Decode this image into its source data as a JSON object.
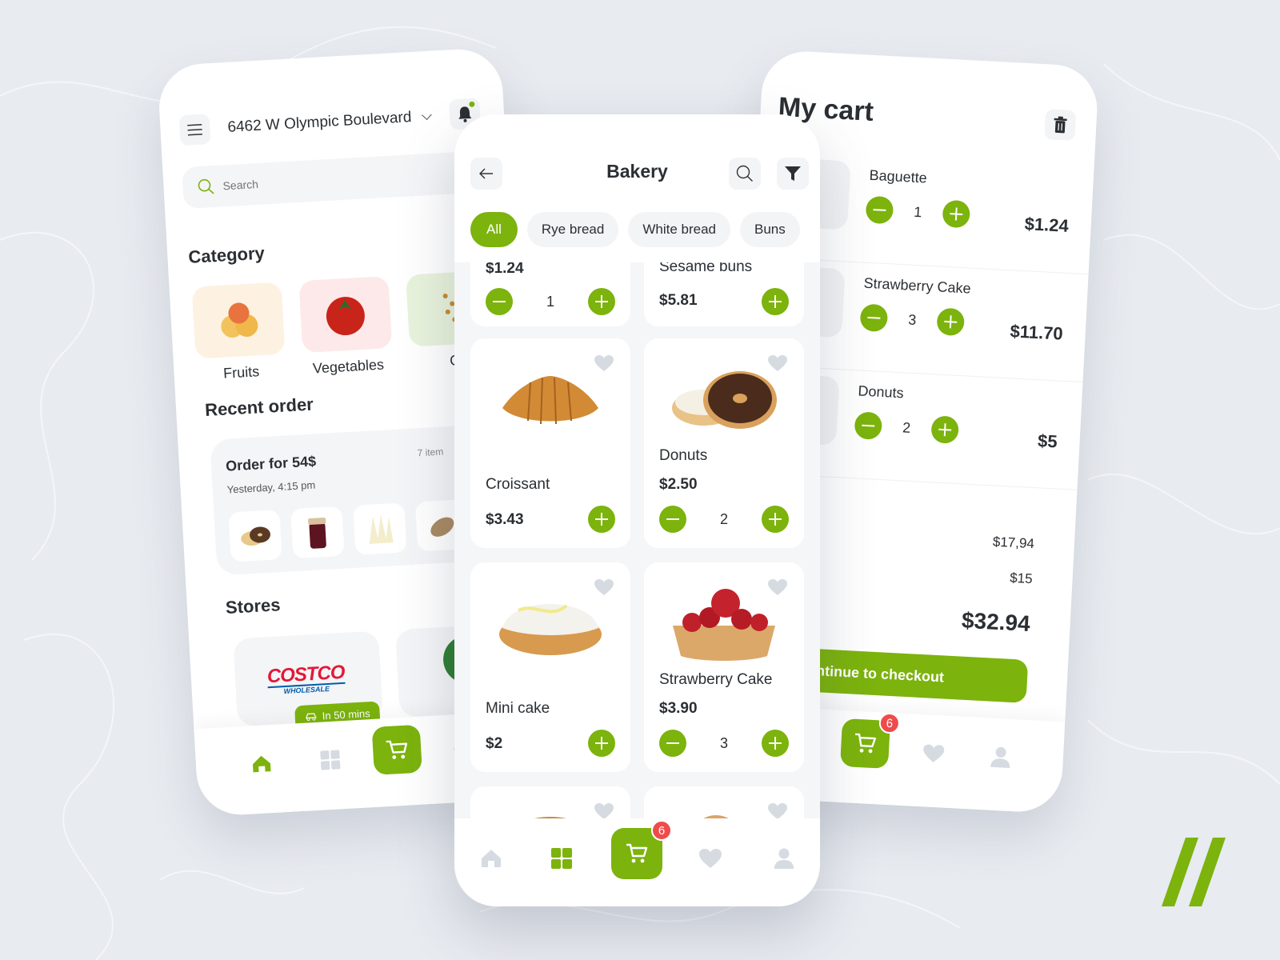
{
  "colors": {
    "accent": "#7cb30d",
    "background": "#e8ebf0",
    "badge": "#ef4b4b",
    "muted_icon": "#d5dbe1",
    "text": "#2b2f33"
  },
  "home_screen": {
    "address": "6462 W Olympic Boulevard",
    "search_placeholder": "Search",
    "category_title": "Category",
    "categories": [
      {
        "label": "Fruits",
        "icon": "apples-image",
        "tint": "#fdf1e1"
      },
      {
        "label": "Vegetables",
        "icon": "tomato-image",
        "tint": "#fde9e9"
      },
      {
        "label": "G",
        "icon": "grains-image",
        "tint": "#e8f3dc"
      }
    ],
    "recent_order_title": "Recent order",
    "recent_order": {
      "title": "Order for 54$",
      "time": "Yesterday, 4:15 pm",
      "count": "7 item",
      "items": [
        "donuts-image",
        "jam-jar-image",
        "cheese-image",
        "bread-image"
      ]
    },
    "stores_title": "Stores",
    "stores": [
      {
        "name": "COSTCO",
        "sub": "WHOLESALE",
        "eta": "In 50 mins"
      }
    ],
    "nav": [
      "home-icon",
      "grid-icon",
      "cart-icon",
      "heart-icon"
    ]
  },
  "bakery_screen": {
    "title": "Bakery",
    "chips": [
      "All",
      "Rye bread",
      "White bread",
      "Buns"
    ],
    "active_chip": "All",
    "products": [
      {
        "name": "Baguette",
        "price": "$1.24",
        "qty": "1"
      },
      {
        "name": "Sesame buns",
        "price": "$5.81",
        "qty": null
      },
      {
        "name": "Croissant",
        "price": "$3.43",
        "qty": null
      },
      {
        "name": "Donuts",
        "price": "$2.50",
        "qty": "2"
      },
      {
        "name": "Mini cake",
        "price": "$2",
        "qty": null
      },
      {
        "name": "Strawberry Cake",
        "price": "$3.90",
        "qty": "3"
      }
    ],
    "cart_badge": "6"
  },
  "cart_screen": {
    "title": "My cart",
    "items": [
      {
        "name": "Baguette",
        "qty": "1",
        "price": "$1.24"
      },
      {
        "name": "Strawberry Cake",
        "qty": "3",
        "price": "$11.70"
      },
      {
        "name": "Donuts",
        "qty": "2",
        "price": "$5"
      }
    ],
    "subtotal": "$17,94",
    "delivery": "$15",
    "total": "$32.94",
    "checkout_label": "Continue to checkout",
    "cart_badge": "6"
  }
}
